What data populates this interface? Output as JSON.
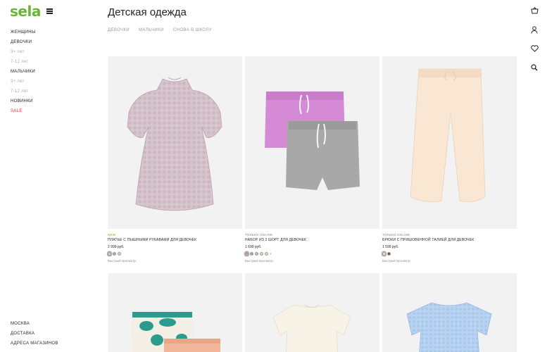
{
  "brand": {
    "logo": "sela"
  },
  "nav": {
    "items": [
      {
        "label": "ЖЕНЩИНЫ",
        "kind": "main"
      },
      {
        "label": "ДЕВОЧКИ",
        "kind": "main"
      },
      {
        "label": "3+ лет",
        "kind": "sub"
      },
      {
        "label": "7-12 лет",
        "kind": "sub"
      },
      {
        "label": "МАЛЬЧИКИ",
        "kind": "main"
      },
      {
        "label": "3+ лет",
        "kind": "sub"
      },
      {
        "label": "7-12 лет",
        "kind": "sub"
      },
      {
        "label": "НОВИНКИ",
        "kind": "main"
      },
      {
        "label": "SALE",
        "kind": "sale"
      }
    ]
  },
  "footer_links": [
    "МОСКВА",
    "ДОСТАВКА",
    "АДРЕСА МАГАЗИНОВ"
  ],
  "header": {
    "title": "Детская одежда",
    "tabs": [
      "ДЕВОЧКИ",
      "МАЛЬЧИКИ",
      "СНОВА В ШКОЛУ"
    ]
  },
  "icons": {
    "cart": "cart-icon",
    "profile": "user-icon",
    "favorites": "heart-icon",
    "search": "search-icon",
    "menu": "menu-icon"
  },
  "colors": {
    "brand_green": "#6bb43a",
    "sale_red": "#d32f2f"
  },
  "products": [
    {
      "badge": "NEW",
      "name": "ПЛАТЬЕ С ПЫШНЫМИ РУКАВАМИ ДЛЯ ДЕВОЧЕК",
      "price": "2 999 руб.",
      "swatches": [
        "#d9c9cf",
        "#b7a5c7",
        "#e6d7dc"
      ],
      "quick": "Быстрый просмотр"
    },
    {
      "badge": "ТОЛЬКО ONLINE",
      "name": "НАБОР ИЗ 2 ШОРТ ДЛЯ ДЕВОЧЕК",
      "price": "1 699 руб.",
      "swatches": [
        "#c68dc4",
        "#a9a9a9",
        "#ccb7c4",
        "#d3e2c3",
        "#e2e7b6"
      ],
      "more": "+",
      "quick": "Быстрый просмотр"
    },
    {
      "badge": "ТОЛЬКО ONLINE",
      "name": "БРЮКИ С ПРИШОВЕННОЙ ТАЛИЕЙ ДЛЯ ДЕВОЧЕК",
      "price": "1 599 руб.",
      "swatches": [
        "#f4e4d3",
        "#7a4a2b"
      ],
      "quick": "Быстрый просмотр"
    }
  ]
}
